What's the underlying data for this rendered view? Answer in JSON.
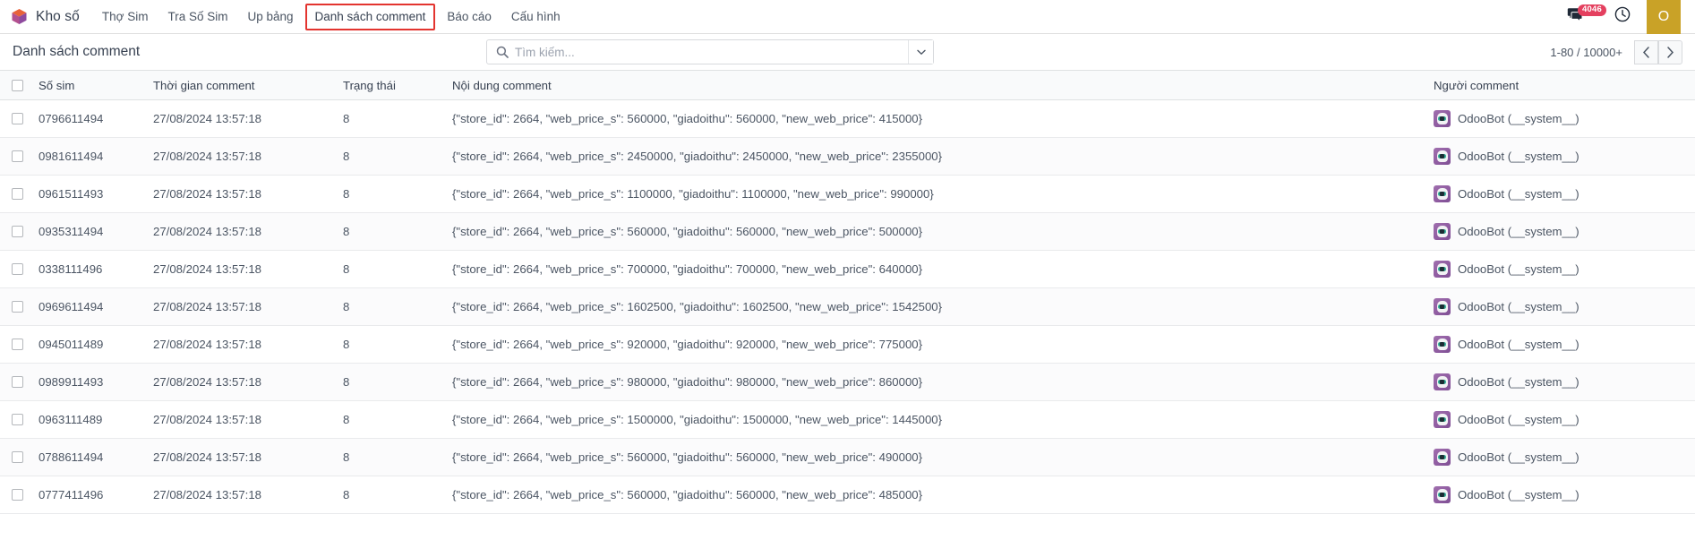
{
  "navbar": {
    "brand": "Kho số",
    "logo_icon": "odoo-cube-logo-icon",
    "menu_items": [
      {
        "label": "Thợ Sim",
        "highlighted": false
      },
      {
        "label": "Tra Số Sim",
        "highlighted": false
      },
      {
        "label": "Up bảng",
        "highlighted": false
      },
      {
        "label": "Danh sách comment",
        "highlighted": true
      },
      {
        "label": "Báo cáo",
        "highlighted": false
      },
      {
        "label": "Cấu hình",
        "highlighted": false
      }
    ],
    "highlight_color": "#e3342f",
    "messages": {
      "icon": "chat-bubble-icon",
      "badge_count": "4046",
      "badge_color": "#e4405f"
    },
    "activities_icon": "clock-icon",
    "avatar": {
      "initial": "O",
      "color": "#c9a227"
    }
  },
  "control_panel": {
    "view_title": "Danh sách comment",
    "search": {
      "icon": "search-icon",
      "placeholder": "Tìm kiếm...",
      "value": "",
      "dropdown_icon": "chevron-down-icon"
    },
    "pager": {
      "range": "1-80 / 10000+",
      "prev_icon": "chevron-left-icon",
      "next_icon": "chevron-right-icon"
    }
  },
  "table": {
    "select_all_checkbox": false,
    "headers": {
      "sim": "Số sim",
      "time": "Thời gian comment",
      "status": "Trạng thái",
      "content": "Nội dung comment",
      "person": "Người comment"
    },
    "rows": [
      {
        "sim": "0796611494",
        "time": "27/08/2024 13:57:18",
        "status": "8",
        "content": "{\"store_id\": 2664, \"web_price_s\": 560000, \"giadoithu\": 560000, \"new_web_price\": 415000}",
        "person": "OdooBot (__system__)"
      },
      {
        "sim": "0981611494",
        "time": "27/08/2024 13:57:18",
        "status": "8",
        "content": "{\"store_id\": 2664, \"web_price_s\": 2450000, \"giadoithu\": 2450000, \"new_web_price\": 2355000}",
        "person": "OdooBot (__system__)"
      },
      {
        "sim": "0961511493",
        "time": "27/08/2024 13:57:18",
        "status": "8",
        "content": "{\"store_id\": 2664, \"web_price_s\": 1100000, \"giadoithu\": 1100000, \"new_web_price\": 990000}",
        "person": "OdooBot (__system__)"
      },
      {
        "sim": "0935311494",
        "time": "27/08/2024 13:57:18",
        "status": "8",
        "content": "{\"store_id\": 2664, \"web_price_s\": 560000, \"giadoithu\": 560000, \"new_web_price\": 500000}",
        "person": "OdooBot (__system__)"
      },
      {
        "sim": "0338111496",
        "time": "27/08/2024 13:57:18",
        "status": "8",
        "content": "{\"store_id\": 2664, \"web_price_s\": 700000, \"giadoithu\": 700000, \"new_web_price\": 640000}",
        "person": "OdooBot (__system__)"
      },
      {
        "sim": "0969611494",
        "time": "27/08/2024 13:57:18",
        "status": "8",
        "content": "{\"store_id\": 2664, \"web_price_s\": 1602500, \"giadoithu\": 1602500, \"new_web_price\": 1542500}",
        "person": "OdooBot (__system__)"
      },
      {
        "sim": "0945011489",
        "time": "27/08/2024 13:57:18",
        "status": "8",
        "content": "{\"store_id\": 2664, \"web_price_s\": 920000, \"giadoithu\": 920000, \"new_web_price\": 775000}",
        "person": "OdooBot (__system__)"
      },
      {
        "sim": "0989911493",
        "time": "27/08/2024 13:57:18",
        "status": "8",
        "content": "{\"store_id\": 2664, \"web_price_s\": 980000, \"giadoithu\": 980000, \"new_web_price\": 860000}",
        "person": "OdooBot (__system__)"
      },
      {
        "sim": "0963111489",
        "time": "27/08/2024 13:57:18",
        "status": "8",
        "content": "{\"store_id\": 2664, \"web_price_s\": 1500000, \"giadoithu\": 1500000, \"new_web_price\": 1445000}",
        "person": "OdooBot (__system__)"
      },
      {
        "sim": "0788611494",
        "time": "27/08/2024 13:57:18",
        "status": "8",
        "content": "{\"store_id\": 2664, \"web_price_s\": 560000, \"giadoithu\": 560000, \"new_web_price\": 490000}",
        "person": "OdooBot (__system__)"
      },
      {
        "sim": "0777411496",
        "time": "27/08/2024 13:57:18",
        "status": "8",
        "content": "{\"store_id\": 2664, \"web_price_s\": 560000, \"giadoithu\": 560000, \"new_web_price\": 485000}",
        "person": "OdooBot (__system__)"
      }
    ]
  }
}
